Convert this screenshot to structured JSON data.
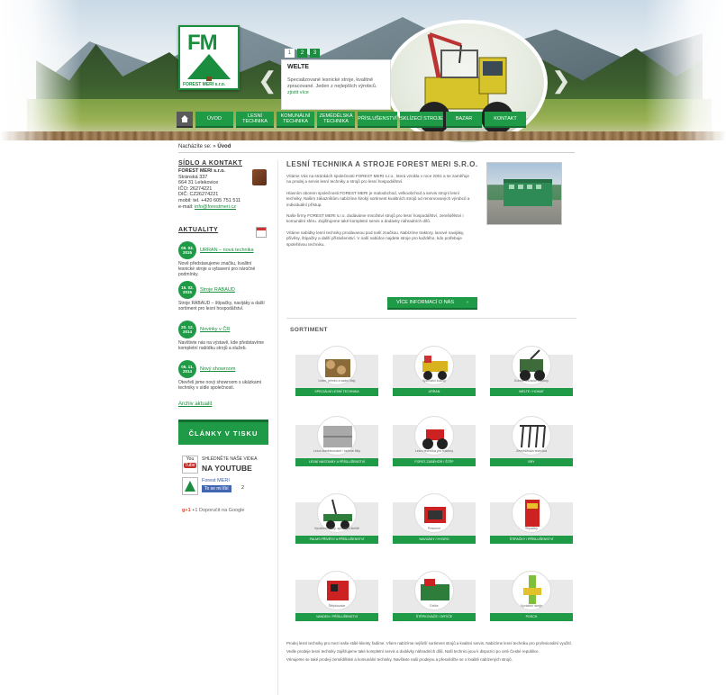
{
  "header": {
    "logo_text": "FM",
    "logo_sub": "FOREST MERI s.r.o.",
    "slider": {
      "numbers": [
        "1",
        "2",
        "3"
      ],
      "title": "WELTE",
      "text": "Specializované lesnické stroje, kvalitně zpracované. Jeden z nejlepších výrobců.",
      "more": "zjistit více"
    },
    "nav": [
      {
        "label": ""
      },
      {
        "label": "Úvod"
      },
      {
        "label": "Lesní technika"
      },
      {
        "label": "Komunální technika"
      },
      {
        "label": "Zemědělská technika"
      },
      {
        "label": "Příslušenství"
      },
      {
        "label": "Sklízecí stroje"
      },
      {
        "label": "Bazar"
      },
      {
        "label": "Kontakt"
      }
    ]
  },
  "breadcrumb": {
    "prefix": "Nacházíte se:",
    "current": "Úvod"
  },
  "sidebar": {
    "contact_heading": "Sídlo a kontakt",
    "contact_lines": [
      "FOREST MERI s.r.o.",
      "Stránská 337",
      "664 31 Lelekovice",
      "IČO: 26274221",
      "DIČ: CZ26274221",
      "mobil: tel. +420 605 751 511"
    ],
    "contact_email_label": "e-mail:",
    "contact_email": "info@forestmeri.cz",
    "news_heading": "Aktuality",
    "news": [
      {
        "date": "09. 03. 2015",
        "title": "URRAN – nová technika",
        "text": "Nově představujeme značku, kvalitní lesnické stroje a vybavení pro náročné podmínky."
      },
      {
        "date": "15. 02. 2015",
        "title": "Stroje RABAUD",
        "text": "Stroje RABAUD – štípačky, navijáky a další sortiment pro lesní hospodářství."
      },
      {
        "date": "20. 12. 2014",
        "title": "Novinky v ČR",
        "text": "Navštivte nás na výstavě, kde představíme kompletní nabídku strojů a služeb."
      },
      {
        "date": "05. 11. 2014",
        "title": "Nový showroom",
        "text": "Otevřeli jsme nový showroom s ukázkami techniky v sídle společnosti."
      }
    ],
    "archive_link": "Archiv aktualit",
    "clanky": "ČLÁNKY V TISKU",
    "youtube_small": "Shlédněte naše videa",
    "youtube_big_prefix": "NA",
    "youtube_big": "YOUTUBE",
    "youtube_logo": "You",
    "youtube_logo_tube": "Tube",
    "facebook_name": "Forest MERI",
    "facebook_btn": "To se mi líbí",
    "facebook_count": "2",
    "gplus_logo": "g+1",
    "gplus_text": "+1  Doporučit na Google"
  },
  "main": {
    "title": "Lesní technika a stroje Forest Meri s.r.o.",
    "paragraphs": [
      "Vítáme Vás na stránkách společnosti FOREST MERI s.r.o., která vznikla v roce 2001 a se zaměřuje na prodej a servis lesní techniky a strojů pro lesní hospodářství.",
      "Hlavním oborem společnosti FOREST MERI je maloobchod, velkoobchod a servis strojní lesní techniky. Našim zákazníkům nabízíme široký sortiment kvalitních strojů od renomovaných výrobců a individuální přístup.",
      "Naše firmy FOREST MERI s.r.o. dodáváme množství strojů pro lesní hospodářství, zemědělství i komunální sféru. Zajišťujeme také kompletní servis a dodávky náhradních dílů.",
      "Vítáme nabídky lesní techniky prodávanou pod naší značkou. Nabízíme traktory, lanové navijáky, přívěsy, štípačky a další příslušenství. V naší nabídce najdete stroje pro každého, kdo potřebuje spolehlivou techniku."
    ],
    "more_button": "Více informací o nás",
    "sortiment_heading": "Sortiment",
    "categories": [
      {
        "name": "Lesní, přední a zadní lišty",
        "bar": "SPECIÁLNÍ LESNÍ TECHNIKA"
      },
      {
        "name": "Speciální kolový",
        "bar": "URRAN"
      },
      {
        "name": "Kolové lesnické traktory",
        "bar": "WELTE / HOMAT"
      },
      {
        "name": "Lesní kombinované / tažené lišty",
        "bar": "LESNÍ NÁSTAVBY A PŘÍSLUŠENSTVÍ"
      },
      {
        "name": "Lesní technika pro traktory",
        "bar": "FORST-ZUBEHÖR / ŠTĚP"
      },
      {
        "name": "Zemědělská technika",
        "bar": "BRY"
      },
      {
        "name": "Vyvážecí vleky, speciální kleště",
        "bar": "PALMS PŘÍVĚSY A PŘÍSLUŠENSTVÍ"
      },
      {
        "name": "Pracovní",
        "bar": "NAVIJÁKY / HYDRO"
      },
      {
        "name": "Štípačky",
        "bar": "ŠTÍPAČKY / PŘÍSLUŠENSTVÍ"
      },
      {
        "name": "Štěpkovače",
        "bar": "VANDEN / PŘÍSLUŠENSTVÍ"
      },
      {
        "name": "Drtiče",
        "bar": "ŠTĚPKOVAČE / DRTIČE"
      },
      {
        "name": "Vyvážecí stroje",
        "bar": "POSCH"
      }
    ],
    "footer_paragraphs": [
      "Prodej lesní techniky pro mezi naše stálé klienty řadíme. Všem nabízíme nejširší sortiment strojů a kvalitní servis. Nabízíme lesní techniku pro profesionální využití.",
      "Vedle prodeje lesní techniky zajišťujeme také kompletní servis a dodávky náhradních dílů. Naši technici jsou k dispozici po celé České republice.",
      "Věnujeme se také prodeji zemědělské a komunální techniky. Navštivte naši prodejnu a přesvědčte se o kvalitě nabízených strojů."
    ]
  },
  "colors": {
    "accent": "#1f9a46",
    "accent_dark": "#146e31",
    "text": "#333333"
  }
}
